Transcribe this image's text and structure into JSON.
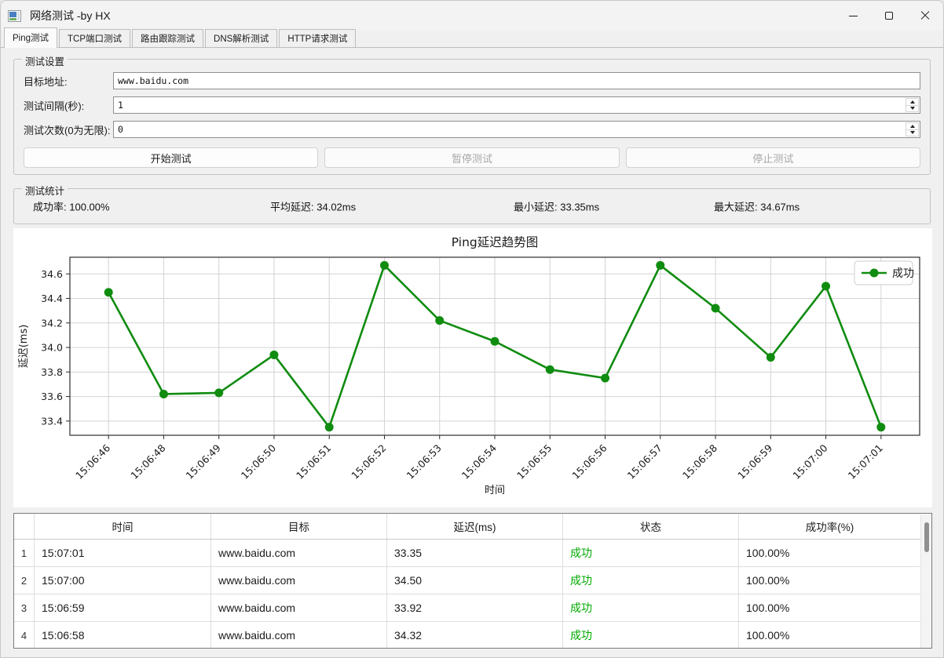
{
  "window": {
    "title": "网络测试 -by HX",
    "icons": {
      "app": "app-window",
      "minimize": "–",
      "maximize": "☐",
      "close": "✕"
    }
  },
  "tabs": [
    {
      "label": "Ping测试",
      "active": true
    },
    {
      "label": "TCP端口测试",
      "active": false
    },
    {
      "label": "路由跟踪测试",
      "active": false
    },
    {
      "label": "DNS解析测试",
      "active": false
    },
    {
      "label": "HTTP请求测试",
      "active": false
    }
  ],
  "settings": {
    "legend": "测试设置",
    "fields": [
      {
        "label": "目标地址:",
        "value": "www.baidu.com",
        "type": "text"
      },
      {
        "label": "测试间隔(秒):",
        "value": "1",
        "type": "spin"
      },
      {
        "label": "测试次数(0为无限):",
        "value": "0",
        "type": "spin"
      }
    ],
    "buttons": [
      {
        "label": "开始测试",
        "enabled": true
      },
      {
        "label": "暂停测试",
        "enabled": false
      },
      {
        "label": "停止测试",
        "enabled": false
      }
    ]
  },
  "stats": {
    "legend": "测试统计",
    "items": [
      {
        "label": "成功率:",
        "value": "100.00%"
      },
      {
        "label": "平均延迟:",
        "value": "34.02ms"
      },
      {
        "label": "最小延迟:",
        "value": "33.35ms"
      },
      {
        "label": "最大延迟:",
        "value": "34.67ms"
      }
    ]
  },
  "chart_data": {
    "type": "line",
    "title": "Ping延迟趋势图",
    "xlabel": "时间",
    "ylabel": "延迟(ms)",
    "x": [
      "15:06:46",
      "15:06:48",
      "15:06:49",
      "15:06:50",
      "15:06:51",
      "15:06:52",
      "15:06:53",
      "15:06:54",
      "15:06:55",
      "15:06:56",
      "15:06:57",
      "15:06:58",
      "15:06:59",
      "15:07:00",
      "15:07:01"
    ],
    "series": [
      {
        "name": "成功",
        "values": [
          34.45,
          33.62,
          33.63,
          33.94,
          33.35,
          34.67,
          34.22,
          34.05,
          33.82,
          33.75,
          34.67,
          34.32,
          33.92,
          34.5,
          33.35
        ]
      }
    ],
    "yticks": [
      33.4,
      33.6,
      33.8,
      34.0,
      34.2,
      34.4,
      34.6
    ],
    "ylim": [
      33.284,
      34.736
    ],
    "grid": true,
    "legend_position": "upper right",
    "line_color": "#108c10"
  },
  "table": {
    "headers": [
      "时间",
      "目标",
      "延迟(ms)",
      "状态",
      "成功率(%)"
    ],
    "rows": [
      {
        "num": "1",
        "time": "15:07:01",
        "target": "www.baidu.com",
        "delay": "33.35",
        "status": "成功",
        "rate": "100.00%"
      },
      {
        "num": "2",
        "time": "15:07:00",
        "target": "www.baidu.com",
        "delay": "34.50",
        "status": "成功",
        "rate": "100.00%"
      },
      {
        "num": "3",
        "time": "15:06:59",
        "target": "www.baidu.com",
        "delay": "33.92",
        "status": "成功",
        "rate": "100.00%"
      },
      {
        "num": "4",
        "time": "15:06:58",
        "target": "www.baidu.com",
        "delay": "34.32",
        "status": "成功",
        "rate": "100.00%"
      }
    ]
  },
  "colors": {
    "line_green": "#108c10",
    "status_green": "#00aa00",
    "window_bg": "#f0f0f0",
    "grid_gray": "#d3d3d3"
  }
}
